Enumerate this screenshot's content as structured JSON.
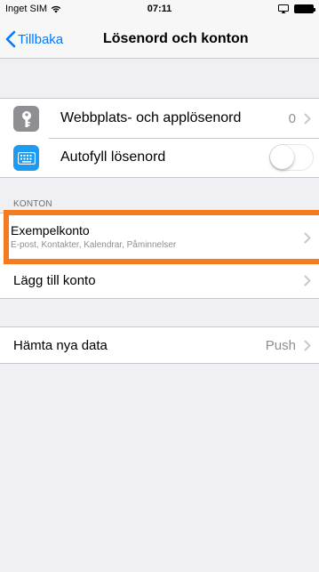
{
  "status_bar": {
    "carrier": "Inget SIM",
    "time": "07:11"
  },
  "nav": {
    "back_label": "Tillbaka",
    "title": "Lösenord och konton"
  },
  "passwords_group": {
    "items": [
      {
        "label": "Webbplats- och applösenord",
        "value": "0",
        "icon": "key-icon"
      },
      {
        "label": "Autofyll lösenord",
        "toggle_on": false,
        "icon": "keyboard-icon"
      }
    ]
  },
  "accounts_section": {
    "header": "KONTON",
    "account": {
      "title": "Exempelkonto",
      "subtitle": "E-post, Kontakter, Kalendrar, Påminnelser"
    },
    "add_account_label": "Lägg till konto"
  },
  "fetch_group": {
    "label": "Hämta nya data",
    "value": "Push"
  },
  "colors": {
    "accent": "#007aff",
    "highlight": "#f47b20",
    "background": "#efeff4"
  }
}
